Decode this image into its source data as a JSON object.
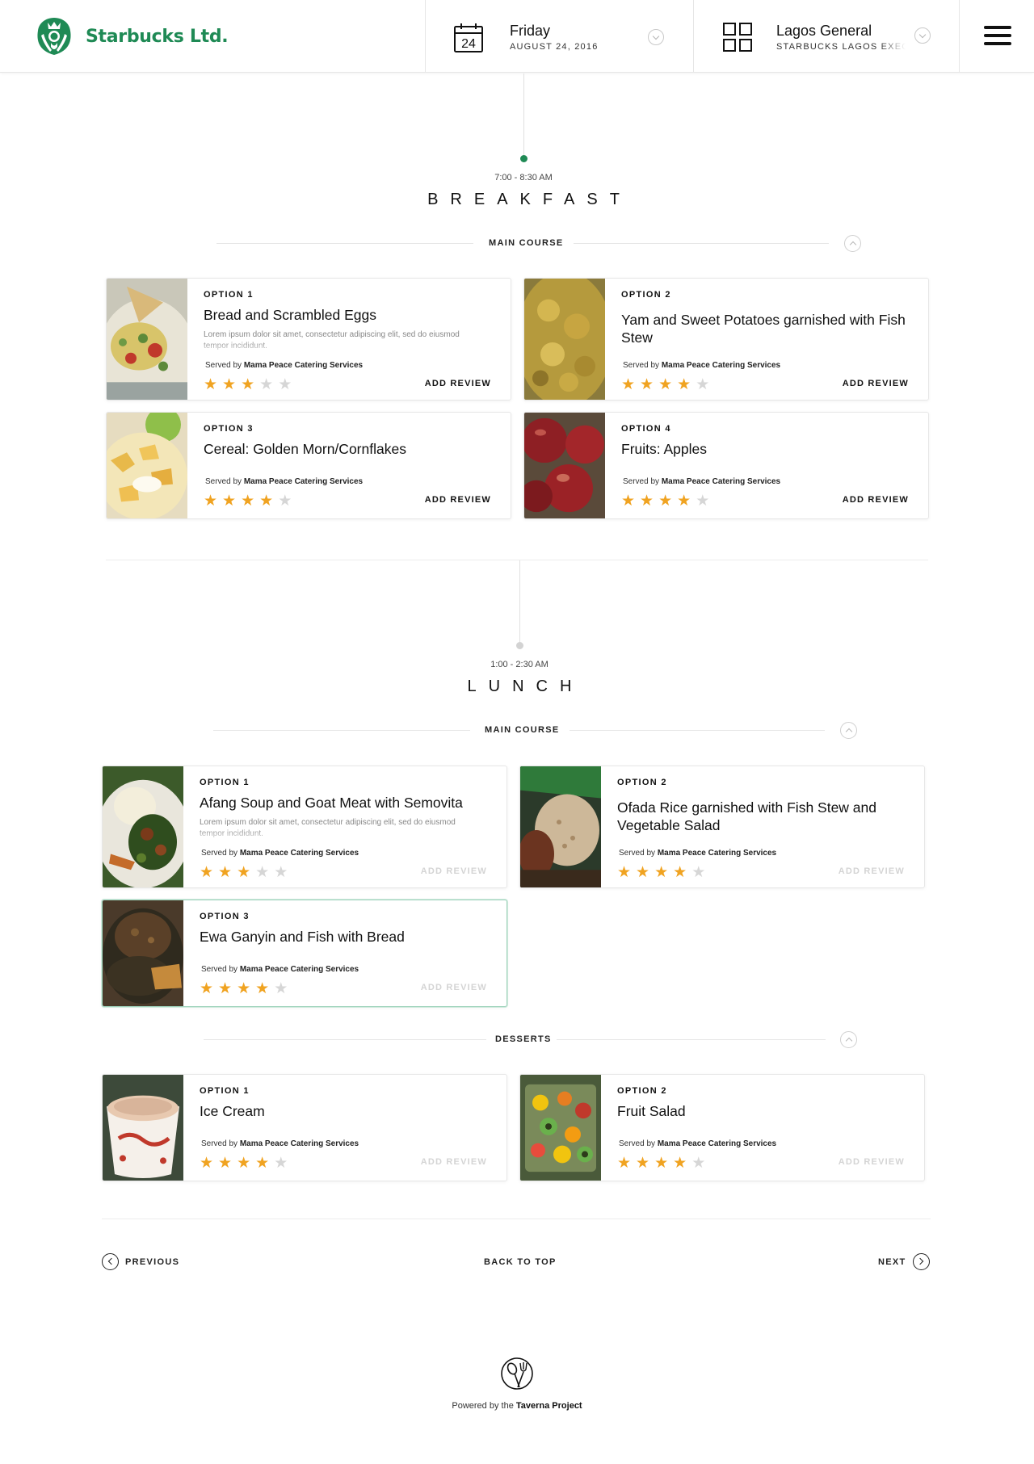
{
  "header": {
    "brand": "Starbucks Ltd.",
    "brand_logo_icon": "starbucks-siren-logo",
    "day_number": "24",
    "day_name": "Friday",
    "date_text": "AUGUST 24, 2016",
    "location_name": "Lagos General",
    "location_sub": "STARBUCKS LAGOS EXECUTIVE",
    "icons": [
      "calendar-icon",
      "grid-icon",
      "chevron-down-icon",
      "hamburger-menu-icon"
    ]
  },
  "colors": {
    "brand_green": "#1f8a55",
    "star_on": "#f0a321",
    "star_off": "#d6d6d6",
    "muted": "#d4d4d4"
  },
  "breakfast": {
    "time": "7:00 - 8:30 AM",
    "title": "BREAKFAST",
    "course_label": "MAIN COURSE",
    "options": [
      {
        "label": "OPTION 1",
        "name": "Bread and Scrambled Eggs",
        "description": "Lorem ipsum dolor sit amet, consectetur adipiscing elit, sed do eiusmod tempor incididunt.",
        "served_prefix": "Served by",
        "caterer": "Mama Peace Catering Services",
        "rating": 3,
        "review_label": "ADD REVIEW",
        "image": "bread-eggs"
      },
      {
        "label": "OPTION 2",
        "name": "Yam and Sweet Potatoes garnished with Fish Stew",
        "served_prefix": "Served by",
        "caterer": "Mama Peace Catering Services",
        "rating": 4,
        "review_label": "ADD REVIEW",
        "image": "yam-potatoes"
      },
      {
        "label": "OPTION 3",
        "name": "Cereal: Golden Morn/Cornflakes",
        "served_prefix": "Served by",
        "caterer": "Mama Peace Catering Services",
        "rating": 4,
        "review_label": "ADD REVIEW",
        "image": "cereal"
      },
      {
        "label": "OPTION 4",
        "name": "Fruits: Apples",
        "served_prefix": "Served by",
        "caterer": "Mama Peace Catering Services",
        "rating": 4,
        "review_label": "ADD REVIEW",
        "image": "apples"
      }
    ]
  },
  "lunch": {
    "time": "1:00 - 2:30 AM",
    "title": "LUNCH",
    "course_label": "MAIN COURSE",
    "options": [
      {
        "label": "OPTION 1",
        "name": "Afang Soup and Goat Meat with Semovita",
        "description": "Lorem ipsum dolor sit amet, consectetur adipiscing elit, sed do eiusmod tempor incididunt.",
        "served_prefix": "Served by",
        "caterer": "Mama Peace Catering Services",
        "rating": 3,
        "review_label": "ADD REVIEW",
        "image": "afang-soup"
      },
      {
        "label": "OPTION 2",
        "name": "Ofada Rice garnished with Fish Stew and Vegetable Salad",
        "served_prefix": "Served by",
        "caterer": "Mama Peace Catering Services",
        "rating": 4,
        "review_label": "ADD REVIEW",
        "image": "ofada-rice"
      },
      {
        "label": "OPTION 3",
        "name": "Ewa Ganyin and Fish with Bread",
        "served_prefix": "Served by",
        "caterer": "Mama Peace Catering Services",
        "rating": 4,
        "review_label": "ADD REVIEW",
        "image": "ewa-ganyin",
        "selected": true
      }
    ],
    "desserts_label": "DESSERTS",
    "desserts": [
      {
        "label": "OPTION 1",
        "name": "Ice Cream",
        "served_prefix": "Served by",
        "caterer": "Mama Peace Catering Services",
        "rating": 4,
        "review_label": "ADD REVIEW",
        "image": "ice-cream"
      },
      {
        "label": "OPTION 2",
        "name": "Fruit Salad",
        "served_prefix": "Served by",
        "caterer": "Mama Peace Catering Services",
        "rating": 4,
        "review_label": "ADD REVIEW",
        "image": "fruit-salad"
      }
    ]
  },
  "footer": {
    "previous": "PREVIOUS",
    "back_to_top": "BACK TO TOP",
    "next": "NEXT",
    "powered_prefix": "Powered by the",
    "powered_brand": "Taverna Project",
    "logo_icon": "taverna-spoon-fork-logo"
  }
}
